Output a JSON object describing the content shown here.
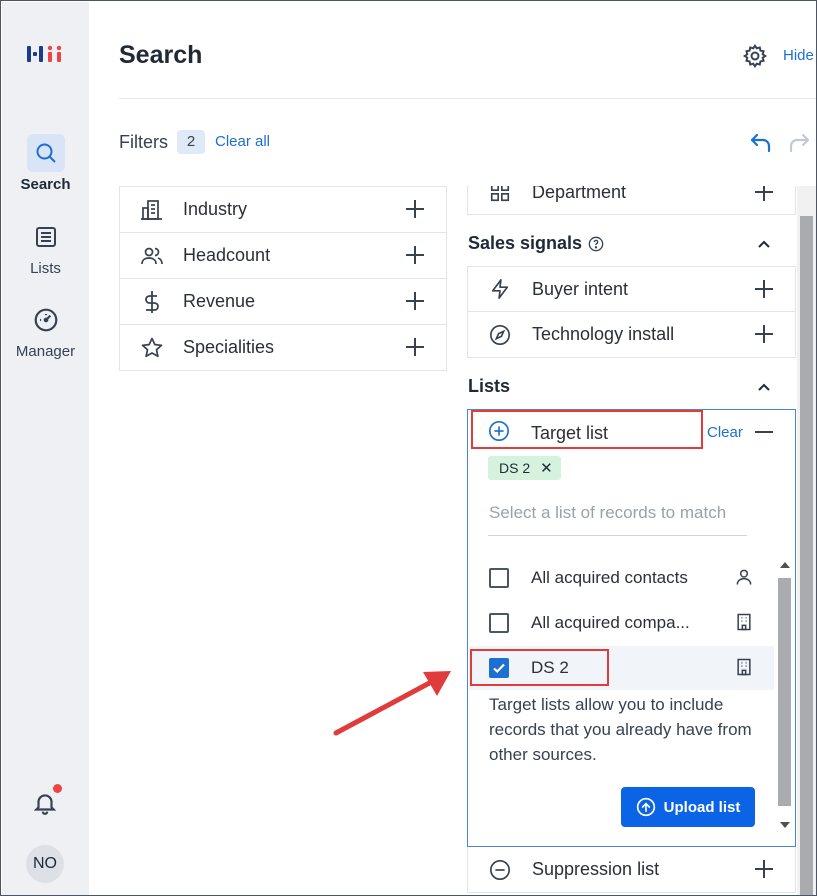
{
  "rail": {
    "search_label": "Search",
    "lists_label": "Lists",
    "manager_label": "Manager",
    "avatar_initials": "NO"
  },
  "header": {
    "title": "Search",
    "hide_label": "Hide"
  },
  "filters": {
    "label": "Filters",
    "count": "2",
    "clear_all": "Clear all"
  },
  "left_filters": [
    {
      "label": "Industry",
      "icon": "building-icon"
    },
    {
      "label": "Headcount",
      "icon": "people-icon"
    },
    {
      "label": "Revenue",
      "icon": "dollar-icon"
    },
    {
      "label": "Specialities",
      "icon": "star-icon"
    }
  ],
  "right": {
    "department": "Department",
    "sales_signals": "Sales signals",
    "buyer_intent": "Buyer intent",
    "technology_install": "Technology install",
    "lists": "Lists",
    "target_list": "Target list",
    "clear": "Clear",
    "chip": "DS 2",
    "placeholder": "Select a list of records to match",
    "options": [
      {
        "label": "All acquired contacts",
        "checked": false,
        "icon": "person-icon"
      },
      {
        "label": "All acquired compa...",
        "checked": false,
        "icon": "company-icon"
      },
      {
        "label": "DS 2",
        "checked": true,
        "icon": "company-icon"
      }
    ],
    "help_text": "Target lists allow you to include records that you already have from other sources.",
    "upload_label": "Upload list",
    "suppression_list": "Suppression list"
  },
  "colors": {
    "accent": "#1d6fd1",
    "button": "#0b63e5",
    "highlight": "#e03c3c",
    "chip": "#d5f2df"
  }
}
